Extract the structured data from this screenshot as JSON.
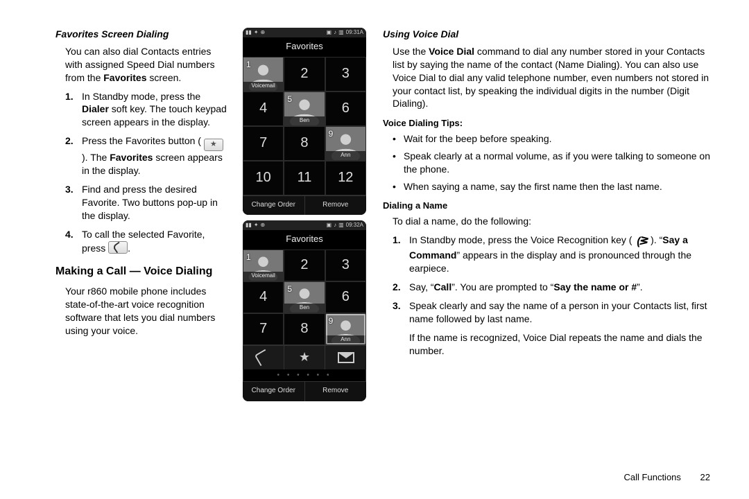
{
  "left": {
    "subhead": "Favorites Screen Dialing",
    "intro_pre": "You can also dial Contacts entries with assigned Speed Dial numbers from the ",
    "intro_bold": "Favorites",
    "intro_post": " screen.",
    "step1_pre": "In Standby mode, press the ",
    "step1_bold": "Dialer",
    "step1_post": " soft key. The touch keypad screen appears in the display.",
    "step2_pre": "Press the Favorites button ( ",
    "step2_mid": " ). The ",
    "step2_bold": "Favorites",
    "step2_post": " screen appears in the display.",
    "step3": "Find and press the desired Favorite. Two buttons pop-up in the display.",
    "step4_pre": "To call the selected Favorite, press ",
    "step4_post": ".",
    "h2": "Making a Call — Voice Dialing",
    "vd_intro": "Your r860 mobile phone includes state-of-the-art voice recognition software that lets you dial numbers using your voice."
  },
  "right": {
    "subhead": "Using Voice Dial",
    "p1_a": "Use the ",
    "p1_b": "Voice Dial",
    "p1_c": " command to dial any number stored in your Contacts list by saying the name of the contact (Name Dialing). You can also use Voice Dial to dial any valid telephone number, even numbers not stored in your contact list, by speaking the individual digits in the number (Digit Dialing).",
    "tips_head": "Voice Dialing Tips:",
    "tip1": "Wait for the beep before speaking.",
    "tip2": "Speak clearly at a normal volume, as if you were talking to someone on the phone.",
    "tip3": "When saying a name, say the first name then the last name.",
    "dial_head": "Dialing a Name",
    "dial_intro": "To dial a name, do the following:",
    "d1_a": "In Standby mode, press the Voice Recognition key ( ",
    "d1_b": " ). “",
    "d1_c": "Say a Command",
    "d1_d": "” appears in the display and is pronounced through the earpiece.",
    "d2_a": "Say, “",
    "d2_b": "Call",
    "d2_c": "”. You are prompted to “",
    "d2_d": "Say the name or #",
    "d2_e": "”.",
    "d3": "Speak clearly and say the name of a person in your Contacts list, first name followed by last name.",
    "d_after": "If the name is recognized, Voice Dial repeats the name and dials the number."
  },
  "phone": {
    "time": "09:31A",
    "title": "Favorites",
    "contacts": {
      "c1": "Voicemail",
      "c5": "Ben",
      "c9": "Ann"
    },
    "sk_left": "Change Order",
    "sk_right": "Remove",
    "time2": "09:32A"
  },
  "footer": {
    "section": "Call Functions",
    "page": "22"
  }
}
